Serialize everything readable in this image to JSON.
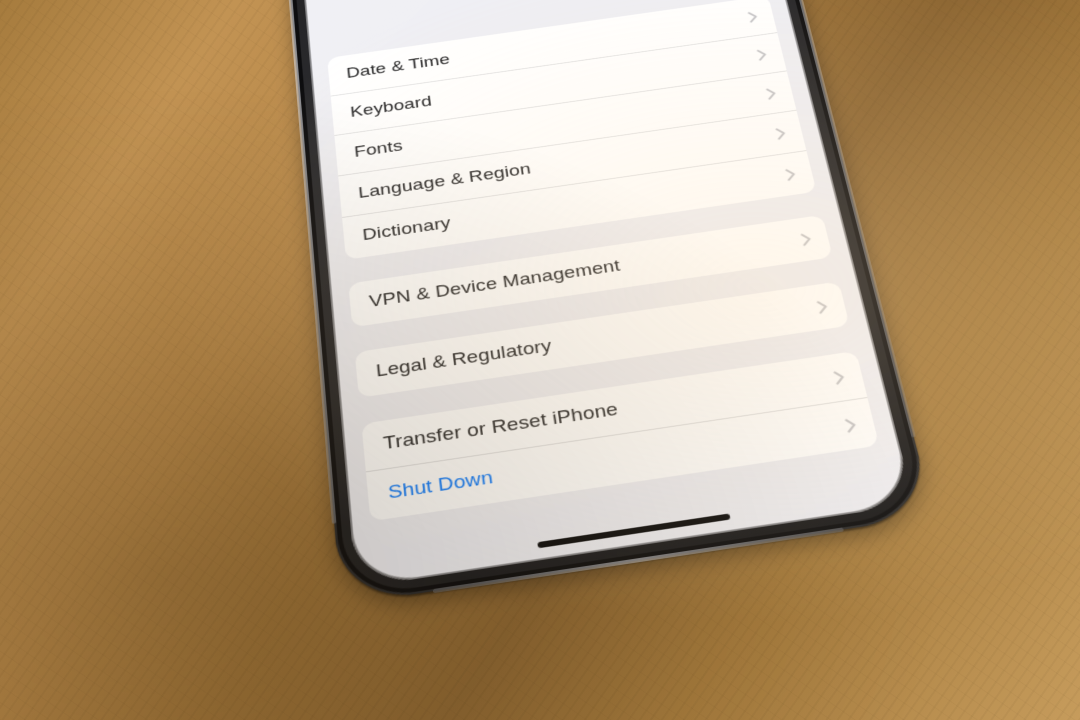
{
  "settings": {
    "groups": [
      {
        "rows": [
          {
            "key": "date_time",
            "label": "Date & Time"
          },
          {
            "key": "keyboard",
            "label": "Keyboard"
          },
          {
            "key": "fonts",
            "label": "Fonts"
          },
          {
            "key": "language_region",
            "label": "Language & Region"
          },
          {
            "key": "dictionary",
            "label": "Dictionary"
          }
        ]
      },
      {
        "rows": [
          {
            "key": "vpn_device_mgmt",
            "label": "VPN & Device Management"
          }
        ]
      },
      {
        "rows": [
          {
            "key": "legal_regulatory",
            "label": "Legal & Regulatory"
          }
        ]
      },
      {
        "rows": [
          {
            "key": "transfer_reset",
            "label": "Transfer or Reset iPhone"
          },
          {
            "key": "shut_down",
            "label": "Shut Down",
            "style": "link"
          }
        ]
      }
    ]
  }
}
